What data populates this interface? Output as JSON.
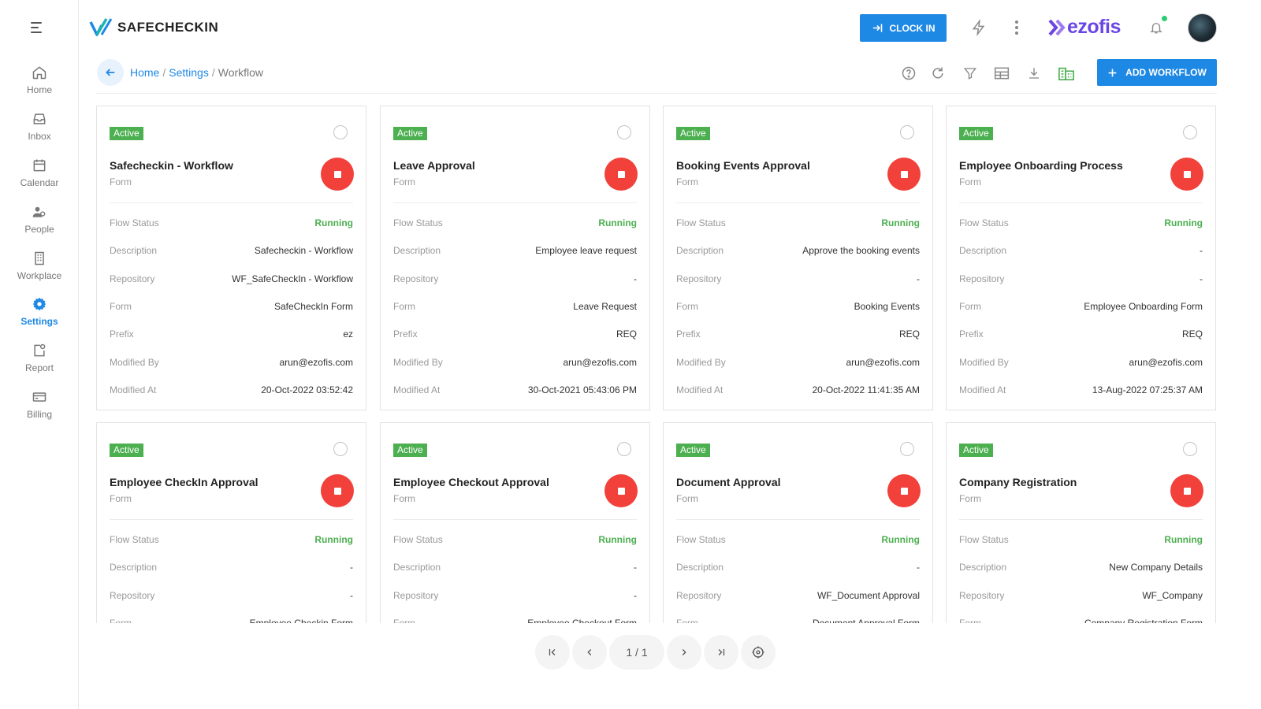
{
  "sidebar": {
    "items": [
      {
        "label": "Home"
      },
      {
        "label": "Inbox"
      },
      {
        "label": "Calendar"
      },
      {
        "label": "People"
      },
      {
        "label": "Workplace"
      },
      {
        "label": "Settings",
        "active": true
      },
      {
        "label": "Report"
      },
      {
        "label": "Billing"
      }
    ]
  },
  "header": {
    "logo_text": "SAFECHECKIN",
    "clockin_label": "CLOCK IN",
    "brand": "ezofis"
  },
  "breadcrumb": {
    "home": "Home",
    "settings": "Settings",
    "current": "Workflow",
    "sep": "/"
  },
  "toolbar": {
    "add_label": "ADD WORKFLOW"
  },
  "field_labels": {
    "flow_status": "Flow Status",
    "description": "Description",
    "repository": "Repository",
    "form": "Form",
    "prefix": "Prefix",
    "modified_by": "Modified By",
    "modified_at": "Modified At"
  },
  "cards": [
    {
      "status": "Active",
      "title": "Safecheckin - Workflow",
      "type": "Form",
      "flow_status": "Running",
      "description": "Safecheckin - Workflow",
      "repository": "WF_SafeCheckIn - Workflow",
      "form": "SafeCheckIn Form",
      "prefix": "ez",
      "modified_by": "arun@ezofis.com",
      "modified_at": "20-Oct-2022 03:52:42"
    },
    {
      "status": "Active",
      "title": "Leave Approval",
      "type": "Form",
      "flow_status": "Running",
      "description": "Employee leave request",
      "repository": "-",
      "form": "Leave Request",
      "prefix": "REQ",
      "modified_by": "arun@ezofis.com",
      "modified_at": "30-Oct-2021 05:43:06 PM"
    },
    {
      "status": "Active",
      "title": "Booking Events Approval",
      "type": "Form",
      "flow_status": "Running",
      "description": "Approve the booking events",
      "repository": "-",
      "form": "Booking Events",
      "prefix": "REQ",
      "modified_by": "arun@ezofis.com",
      "modified_at": "20-Oct-2022 11:41:35 AM"
    },
    {
      "status": "Active",
      "title": "Employee Onboarding Process",
      "type": "Form",
      "flow_status": "Running",
      "description": "-",
      "repository": "-",
      "form": "Employee Onboarding Form",
      "prefix": "REQ",
      "modified_by": "arun@ezofis.com",
      "modified_at": "13-Aug-2022 07:25:37 AM"
    },
    {
      "status": "Active",
      "title": "Employee CheckIn Approval",
      "type": "Form",
      "flow_status": "Running",
      "description": "-",
      "repository": "-",
      "form": "Employee Checkin Form",
      "prefix": "",
      "modified_by": "",
      "modified_at": ""
    },
    {
      "status": "Active",
      "title": "Employee Checkout Approval",
      "type": "Form",
      "flow_status": "Running",
      "description": "-",
      "repository": "-",
      "form": "Employee Checkout Form",
      "prefix": "",
      "modified_by": "",
      "modified_at": ""
    },
    {
      "status": "Active",
      "title": "Document Approval",
      "type": "Form",
      "flow_status": "Running",
      "description": "-",
      "repository": "WF_Document Approval",
      "form": "Document Approval Form",
      "prefix": "",
      "modified_by": "",
      "modified_at": ""
    },
    {
      "status": "Active",
      "title": "Company Registration",
      "type": "Form",
      "flow_status": "Running",
      "description": "New Company Details",
      "repository": "WF_Company",
      "form": "Company Registration Form",
      "prefix": "",
      "modified_by": "",
      "modified_at": ""
    }
  ],
  "pagination": {
    "label": "1 / 1"
  },
  "colors": {
    "accent": "#1e88e5",
    "active_badge": "#4caf50",
    "stop": "#f2403a",
    "running": "#4caf50",
    "brand": "#6b46e3"
  }
}
